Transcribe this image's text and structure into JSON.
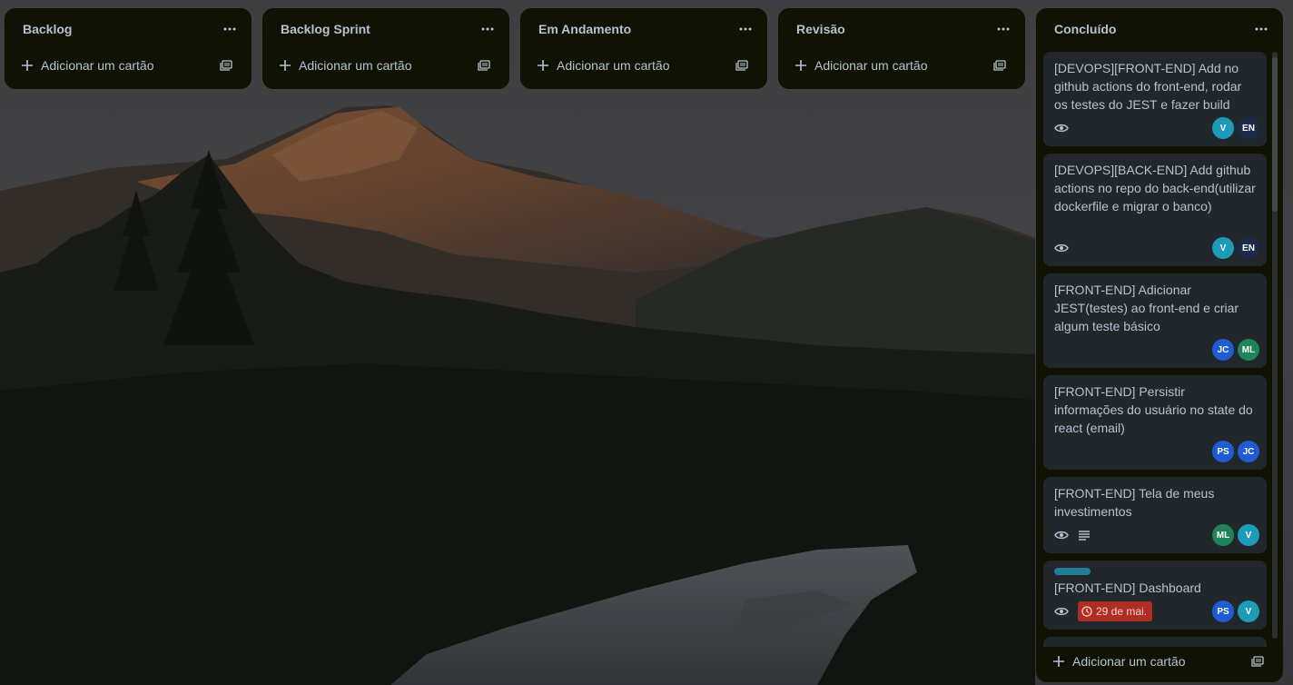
{
  "colors": {
    "list_bg": "#101204",
    "card_bg": "#22272b",
    "text": "#b6c2cf",
    "label_teal": "#227d9b",
    "due_overdue": "#ae2e24"
  },
  "lists": [
    {
      "title": "Backlog",
      "add_label": "Adicionar um cartão"
    },
    {
      "title": "Backlog Sprint",
      "add_label": "Adicionar um cartão"
    },
    {
      "title": "Em Andamento",
      "add_label": "Adicionar um cartão"
    },
    {
      "title": "Revisão",
      "add_label": "Adicionar um cartão"
    },
    {
      "title": "Concluído",
      "add_label": "Adicionar um cartão",
      "cards": [
        {
          "title": "[DEVOPS][FRONT-END] Add no github actions do front-end, rodar os testes do JEST e fazer build",
          "badges": [
            "eye-icon"
          ],
          "members": [
            {
              "initials": "V",
              "color": "#1d9bb8"
            },
            {
              "initials": "EN",
              "color": "#1c2b4a"
            }
          ]
        },
        {
          "title": "[DEVOPS][BACK-END] Add github actions no repo do back-end(utilizar dockerfile e migrar o banco)",
          "badges": [
            "eye-icon"
          ],
          "members": [
            {
              "initials": "V",
              "color": "#1d9bb8"
            },
            {
              "initials": "EN",
              "color": "#1c2b4a"
            }
          ]
        },
        {
          "title": "[FRONT-END] Adicionar JEST(testes) ao front-end e criar algum teste básico",
          "badges": [],
          "members": [
            {
              "initials": "JC",
              "color": "#1f5bd1"
            },
            {
              "initials": "ML",
              "color": "#1f845a"
            }
          ]
        },
        {
          "title": "[FRONT-END] Persistir informações do usuário no state do react (email)",
          "badges": [],
          "members": [
            {
              "initials": "PS",
              "color": "#1f5bd1"
            },
            {
              "initials": "JC",
              "color": "#1f5bd1"
            }
          ]
        },
        {
          "title": "[FRONT-END] Tela de meus investimentos",
          "badges": [
            "eye-icon",
            "description-icon"
          ],
          "members": [
            {
              "initials": "ML",
              "color": "#1f845a"
            },
            {
              "initials": "V",
              "color": "#1d9bb8"
            }
          ]
        },
        {
          "title": "[FRONT-END] Dashboard",
          "label_color": "#227d9b",
          "badges": [
            "eye-icon"
          ],
          "due": "29 de mai.",
          "members": [
            {
              "initials": "PS",
              "color": "#1f5bd1"
            },
            {
              "initials": "V",
              "color": "#1d9bb8"
            }
          ]
        }
      ]
    }
  ]
}
